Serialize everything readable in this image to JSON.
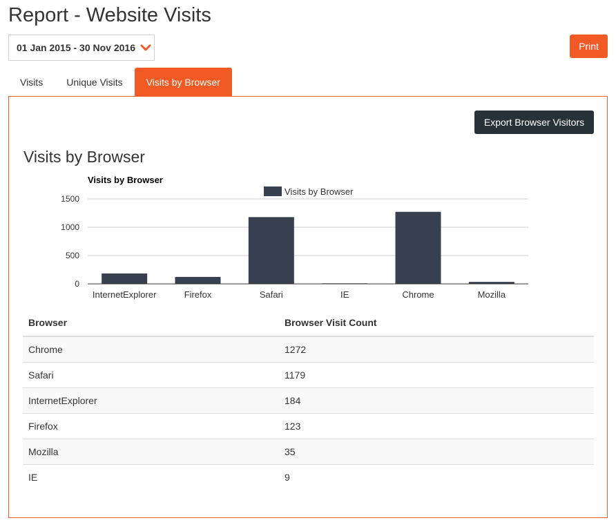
{
  "page": {
    "title": "Report - Website Visits"
  },
  "date_range": {
    "label": "01 Jan 2015 - 30 Nov 2016",
    "icon": "chevron-down-icon",
    "icon_color": "#f15a24"
  },
  "print_button": {
    "label": "Print"
  },
  "colors": {
    "accent": "#f15a24",
    "dark_button": "#263238",
    "bar": "#37404e"
  },
  "tabs": [
    {
      "label": "Visits",
      "active": false
    },
    {
      "label": "Unique Visits",
      "active": false
    },
    {
      "label": "Visits by Browser",
      "active": true
    }
  ],
  "panel": {
    "export_button": {
      "label": "Export Browser Visitors"
    },
    "section_title": "Visits by Browser"
  },
  "chart_data": {
    "type": "bar",
    "title": "Visits by Browser",
    "categories": [
      "InternetExplorer",
      "Firefox",
      "Safari",
      "IE",
      "Chrome",
      "Mozilla"
    ],
    "series": [
      {
        "name": "Visits by Browser",
        "values": [
          184,
          123,
          1179,
          9,
          1272,
          35
        ]
      }
    ],
    "ylim": [
      0,
      1500
    ],
    "yticks": [
      0,
      500,
      1000,
      1500
    ],
    "legend_position": "top",
    "grid": true
  },
  "table": {
    "headers": [
      "Browser",
      "Browser Visit Count"
    ],
    "rows": [
      [
        "Chrome",
        "1272"
      ],
      [
        "Safari",
        "1179"
      ],
      [
        "InternetExplorer",
        "184"
      ],
      [
        "Firefox",
        "123"
      ],
      [
        "Mozilla",
        "35"
      ],
      [
        "IE",
        "9"
      ]
    ]
  }
}
